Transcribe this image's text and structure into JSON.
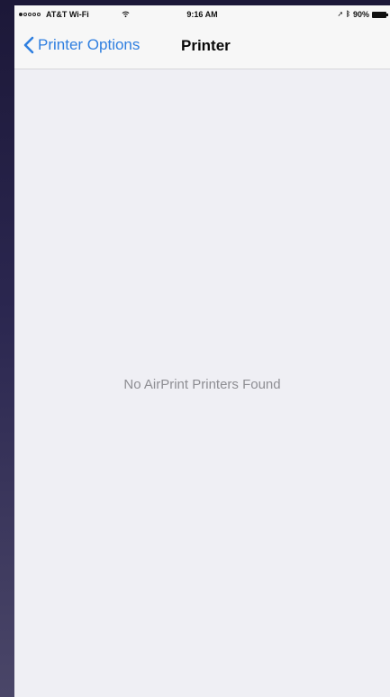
{
  "status_bar": {
    "carrier": "AT&T Wi-Fi",
    "time": "9:16 AM",
    "battery": "90%",
    "icons": [
      "signal-dots-icon",
      "wifi-icon",
      "location-arrow-icon",
      "bluetooth-icon",
      "battery-icon"
    ]
  },
  "nav": {
    "back_label": "Printer Options",
    "back_icon": "chevron-left-icon",
    "title": "Printer",
    "accent_color": "#2f7fe0"
  },
  "content": {
    "empty_message": "No AirPrint Printers Found"
  }
}
